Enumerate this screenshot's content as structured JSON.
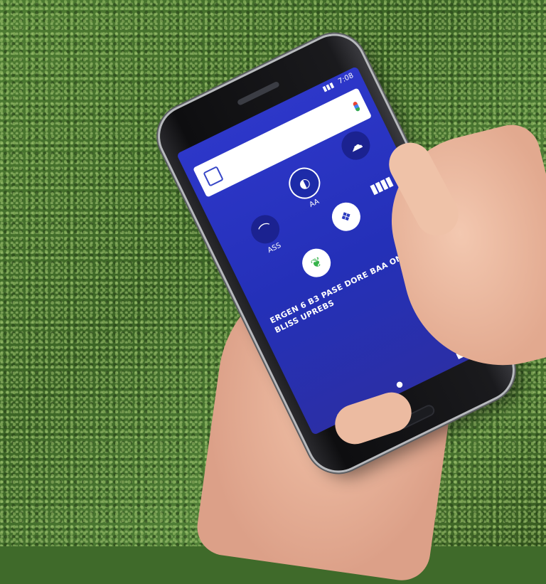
{
  "scene": {
    "description_labels": {
      "background": "hedge-background",
      "device": "smartphone"
    }
  },
  "phone": {
    "status_time": "7:08",
    "apps": [
      {
        "label": "AA",
        "icon": "globe-icon"
      },
      {
        "label": "",
        "icon": "cloud-icon"
      },
      {
        "label": "ASS",
        "icon": "circle-icon"
      },
      {
        "label": "",
        "icon": "leaf-icon"
      },
      {
        "label": "",
        "icon": "bars-icon"
      }
    ],
    "screen_text": "ERGEN 6 B3 PASE DORE BAA ONZS BLISS UPREBS"
  },
  "colors": {
    "screen": "#2d37c9",
    "hedge": "#3f6a2a",
    "skin": "#f0c2a8"
  }
}
